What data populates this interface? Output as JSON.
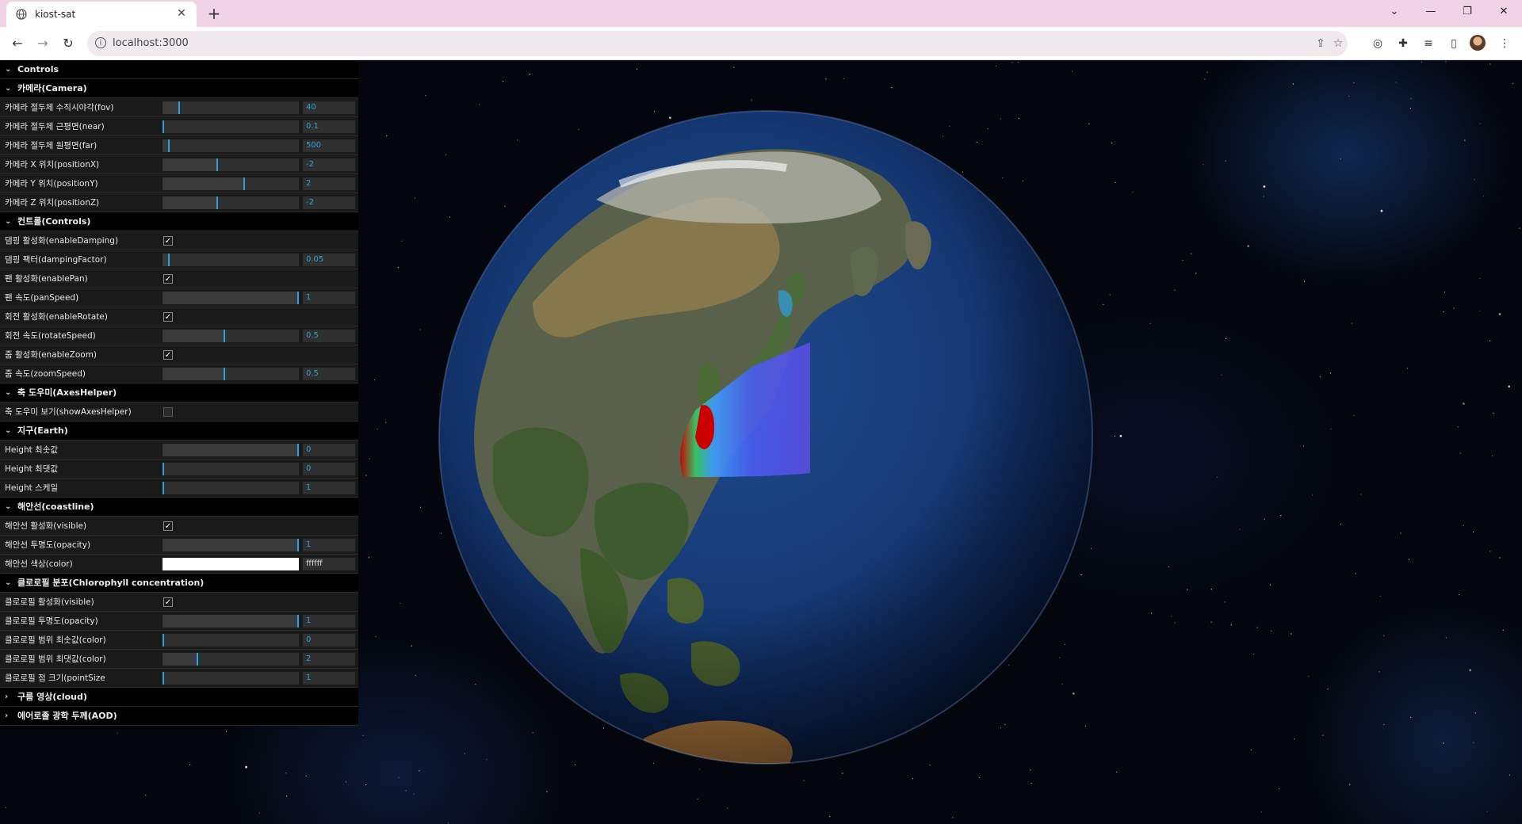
{
  "browser": {
    "tab_title": "kiost-sat",
    "new_tab_symbol": "+",
    "url": "localhost:3000",
    "window_controls": {
      "minimize": "—",
      "maximize": "❐",
      "close": "✕"
    }
  },
  "panel": {
    "title": "Controls",
    "folders": [
      {
        "title": "카메라(Camera)",
        "open": true,
        "rows": [
          {
            "label": "카메라 절두체 수직시야각(fov)",
            "type": "slider",
            "value": "40",
            "level": 0.12
          },
          {
            "label": "카메라 절두체 근평면(near)",
            "type": "slider",
            "value": "0.1",
            "level": 0.0
          },
          {
            "label": "카메라 절두체 원평면(far)",
            "type": "slider",
            "value": "500",
            "level": 0.04
          },
          {
            "label": "카메라 X 위치(positionX)",
            "type": "slider",
            "value": "-2",
            "level": 0.4
          },
          {
            "label": "카메라 Y 위치(positionY)",
            "type": "slider",
            "value": "2",
            "level": 0.6
          },
          {
            "label": "카메라 Z 위치(positionZ)",
            "type": "slider",
            "value": "-2",
            "level": 0.4
          }
        ]
      },
      {
        "title": "컨트롤(Controls)",
        "open": true,
        "rows": [
          {
            "label": "댐핑 활성화(enableDamping)",
            "type": "checkbox",
            "checked": true
          },
          {
            "label": "댐핑 팩터(dampingFactor)",
            "type": "slider",
            "value": "0.05",
            "level": 0.04
          },
          {
            "label": "팬 활성화(enablePan)",
            "type": "checkbox",
            "checked": true
          },
          {
            "label": "팬 속도(panSpeed)",
            "type": "slider",
            "value": "1",
            "level": 1.0
          },
          {
            "label": "회전 활성화(enableRotate)",
            "type": "checkbox",
            "checked": true
          },
          {
            "label": "회전 속도(rotateSpeed)",
            "type": "slider",
            "value": "0.5",
            "level": 0.45
          },
          {
            "label": "줌 활성화(enableZoom)",
            "type": "checkbox",
            "checked": true
          },
          {
            "label": "줌 속도(zoomSpeed)",
            "type": "slider",
            "value": "0.5",
            "level": 0.45
          }
        ]
      },
      {
        "title": "축 도우미(AxesHelper)",
        "open": true,
        "rows": [
          {
            "label": "축 도우미 보기(showAxesHelper)",
            "type": "checkbox",
            "checked": false
          }
        ]
      },
      {
        "title": "지구(Earth)",
        "open": true,
        "rows": [
          {
            "label": "Height 최솟값",
            "type": "slider",
            "value": "0",
            "level": 1.0
          },
          {
            "label": "Height 최댓값",
            "type": "slider",
            "value": "0",
            "level": 0.0
          },
          {
            "label": "Height 스케일",
            "type": "slider",
            "value": "1",
            "level": 0.0
          }
        ]
      },
      {
        "title": "해안선(coastline)",
        "open": true,
        "rows": [
          {
            "label": "해안선 활성화(visible)",
            "type": "checkbox",
            "checked": true
          },
          {
            "label": "해안선 투명도(opacity)",
            "type": "slider",
            "value": "1",
            "level": 1.0
          },
          {
            "label": "해안선 색상(color)",
            "type": "color",
            "value": "ffffff",
            "swatch": "#ffffff"
          }
        ]
      },
      {
        "title": "클로로필 분포(Chlorophyll concentration)",
        "open": true,
        "rows": [
          {
            "label": "클로로필 활성화(visible)",
            "type": "checkbox",
            "checked": true
          },
          {
            "label": "클로로필 투명도(opacity)",
            "type": "slider",
            "value": "1",
            "level": 1.0
          },
          {
            "label": "클로로필 범위 최솟값(color)",
            "type": "slider",
            "value": "0",
            "level": 0.0
          },
          {
            "label": "클로로필 범위 최댓값(color)",
            "type": "slider",
            "value": "2",
            "level": 0.25
          },
          {
            "label": "클로로필 점 크기(pointSize",
            "type": "slider",
            "value": "1",
            "level": 0.0
          }
        ]
      },
      {
        "title": "구름 영상(cloud)",
        "open": false,
        "rows": []
      },
      {
        "title": "에어로졸 광학 두께(AOD)",
        "open": false,
        "rows": []
      }
    ]
  },
  "colors": {
    "accent": "#2fa1d6",
    "panel_bg": "#1a1a1a",
    "tabbar_bg": "#f1d3e6"
  }
}
